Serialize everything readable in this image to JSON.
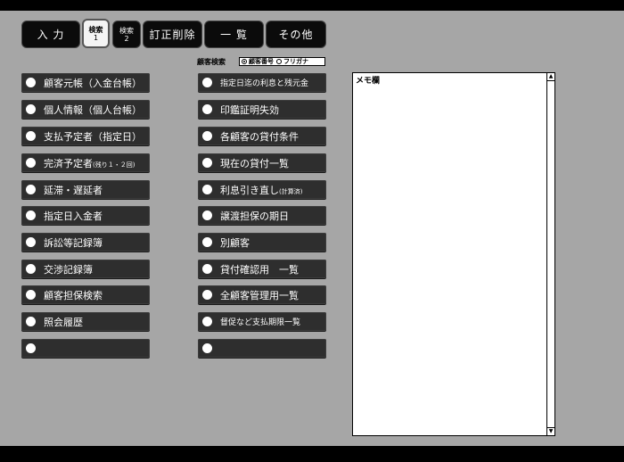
{
  "tabs": {
    "input": "入 力",
    "search1_main": "検索",
    "search1_sub": "1",
    "search2_main": "検索",
    "search2_sub": "2",
    "correct_delete": "訂正削除",
    "list": "一 覧",
    "other": "その他"
  },
  "customer_search": {
    "label": "顧客検索",
    "option_number": "顧客番号",
    "option_kana": "フリガナ"
  },
  "left_buttons": [
    "顧客元帳（入金台帳）",
    "個人情報（個人台帳）",
    "支払予定者（指定日）",
    "完済予定者",
    "延滞・遅延者",
    "指定日入金者",
    "訴訟等記録簿",
    "交渉記録簿",
    "顧客担保検索",
    "照会履歴",
    ""
  ],
  "left_button_notes": {
    "completion_note": "(残り１・２回)"
  },
  "right_buttons": [
    "指定日迄の利息と残元金",
    "印鑑証明失効",
    "各顧客の貸付条件",
    "現在の貸付一覧",
    "利息引き直し",
    "譲渡担保の期日",
    "別顧客",
    "貸付確認用　一覧",
    "全顧客管理用一覧",
    "督促など支払期限一覧",
    ""
  ],
  "right_button_notes": {
    "recalc_note": "(計算済)"
  },
  "memo": {
    "label": "メモ欄"
  }
}
